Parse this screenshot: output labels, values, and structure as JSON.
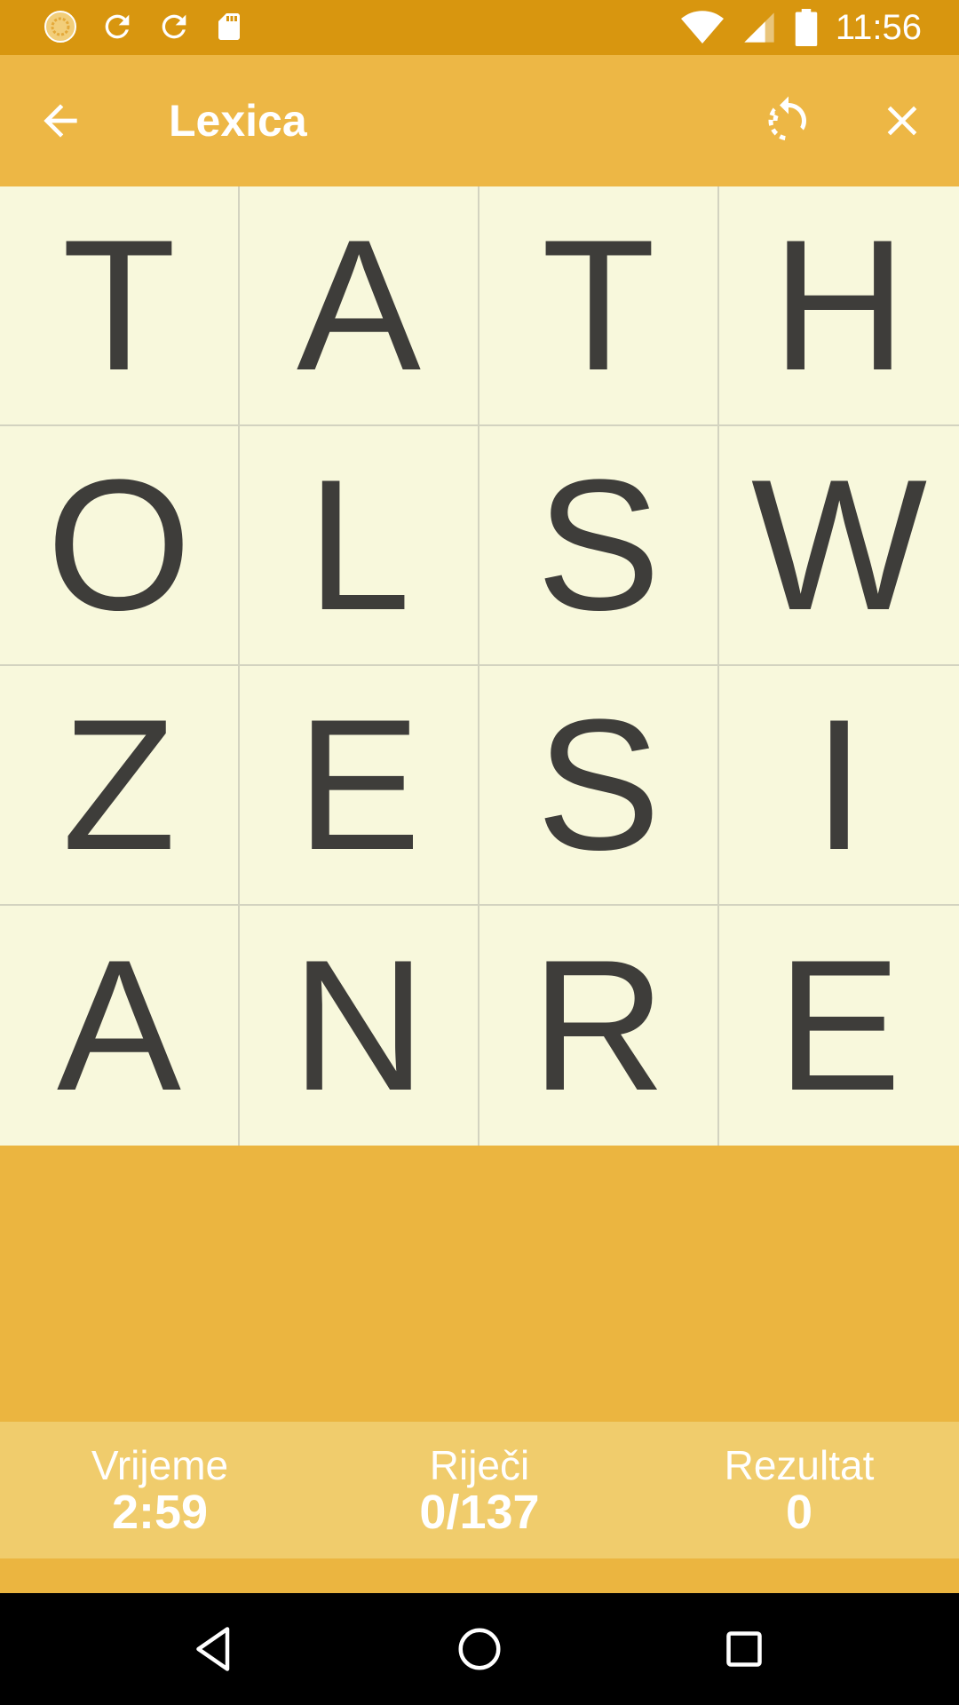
{
  "status_bar": {
    "time": "11:56",
    "icons": [
      "app-notification-icon",
      "sync-icon",
      "sync-icon",
      "sd-card-icon",
      "wifi-icon",
      "cell-signal-icon",
      "battery-icon"
    ]
  },
  "app_bar": {
    "title": "Lexica",
    "icons": [
      "back-arrow-icon",
      "refresh-icon",
      "close-icon"
    ]
  },
  "board": {
    "rows": [
      [
        "T",
        "A",
        "T",
        "H"
      ],
      [
        "O",
        "L",
        "S",
        "W"
      ],
      [
        "Z",
        "E",
        "S",
        "I"
      ],
      [
        "A",
        "N",
        "R",
        "E"
      ]
    ]
  },
  "stats": {
    "time_label": "Vrijeme",
    "time_value": "2:59",
    "words_label": "Riječi",
    "words_value": "0/137",
    "score_label": "Rezultat",
    "score_value": "0"
  },
  "nav": {
    "icons": [
      "nav-back-icon",
      "nav-home-icon",
      "nav-recents-icon"
    ]
  },
  "colors": {
    "status_bar": "#D8960F",
    "app_bar": "#EDB745",
    "board_bg": "#F8F8DC",
    "stats_bg": "#F0CC6C",
    "letter": "#3E3D3A"
  }
}
